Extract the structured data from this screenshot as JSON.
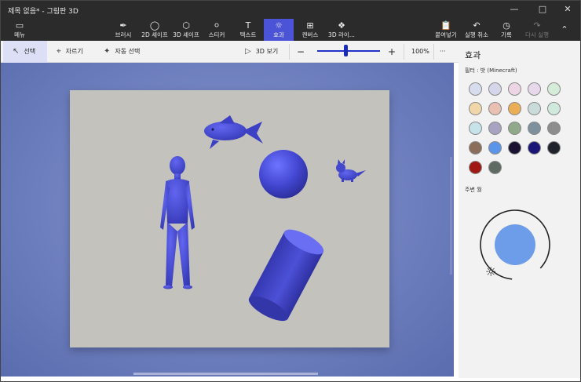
{
  "window": {
    "title": "제목 없음* - 그림판 3D",
    "minimize_icon": "minimize-icon",
    "maximize_icon": "maximize-icon",
    "close_icon": "close-icon"
  },
  "ribbon": {
    "menu": "메뉴",
    "brushes": "브러시",
    "shapes_2d": "2D 셰이프",
    "shapes_3d": "3D 셰이프",
    "stickers": "스티커",
    "text": "텍스트",
    "effects": "효과",
    "canvas": "캔버스",
    "library_3d": "3D 라이...",
    "paste": "붙여넣기",
    "undo": "실행 취소",
    "history": "기록",
    "redo": "다시 실행",
    "active_tab": "효과"
  },
  "toolbar": {
    "select": "선택",
    "crop": "자르기",
    "magic_select": "자동 선택",
    "view_3d": "3D 보기",
    "zoom_out": "−",
    "zoom_in": "+",
    "zoom_level": "100%",
    "zoom_fraction": 0.45,
    "more": "···"
  },
  "effects_panel": {
    "title": "효과",
    "filter_label": "필터 : 밧 (Minecraft)",
    "light_label": "주변 월",
    "swatch_colors": [
      "#d8ddee",
      "#d5d6ea",
      "#eed5e6",
      "#e7d8ec",
      "#d5ecd9",
      "#f0d6a9",
      "#e9c0b2",
      "#eaae57",
      "#c9dcda",
      "#cfe9dc",
      "#c6e3ea",
      "#a7a3c0",
      "#90a98a",
      "#7e909b",
      "#8d8d8d",
      "#8b6e5a",
      "#5b95e9",
      "#1a1230",
      "#1c1578",
      "#1f222b",
      "#a01813",
      "#5f6a62"
    ],
    "light_color": "#6d9de8"
  },
  "canvas": {
    "paper_color": "#c4c2bd",
    "object_color": "#4b4fd3"
  }
}
